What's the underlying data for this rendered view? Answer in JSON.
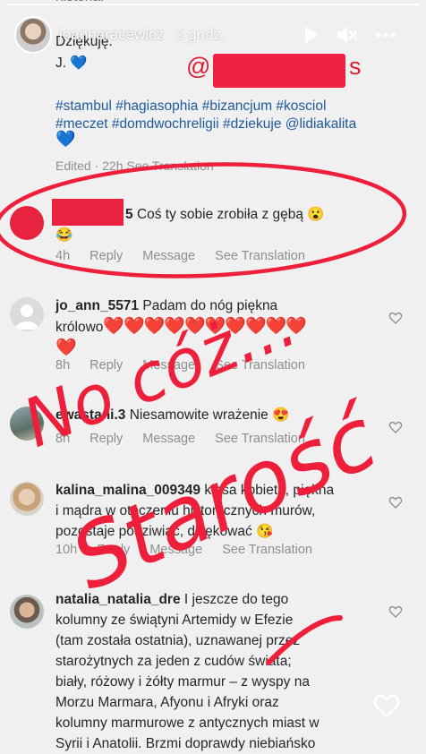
{
  "story": {
    "username": "joannaracewicz",
    "time": "2 godz.",
    "icons": [
      "play-icon",
      "mute-icon",
      "more-icon",
      "like-icon"
    ]
  },
  "caption": {
    "line_top": "historia.",
    "line_thanks": "Dziękuję.",
    "line_sign": "J. 💙",
    "mention_visible": "@",
    "mention_tail": "s",
    "hashtags_1": "#stambul #hagiasophia #bizancjum #kosciol",
    "hashtags_2": "#meczet #domdwochreligii #dziekuje @lidiakalita",
    "hashtags_3": "💙",
    "meta": "Edited · 22h    See Translation"
  },
  "comments": [
    {
      "user": "",
      "user_suffix": "5",
      "text": "Coś ty sobie zrobiła z gębą 😮",
      "text2": "😂",
      "time": "4h",
      "reply": "Reply",
      "message": "Message",
      "translate": "See Translation"
    },
    {
      "user": "jo_ann_5571",
      "text": "Padam do nóg piękna",
      "text2": "królowo",
      "hearts": "❤️❤️❤️❤️❤️❤️❤️❤️❤️❤️",
      "hearts2": "❤️",
      "time": "8h",
      "reply": "Reply",
      "message": "Message",
      "translate": "See Translation"
    },
    {
      "user": "ewastani.3",
      "text": "Niesamowite wrażenie 😍",
      "time": "8h",
      "reply": "Reply",
      "message": "Message",
      "translate": "See Translation"
    },
    {
      "user": "kalina_malina_009349",
      "text": "klasa kobieta, piękna",
      "text2": "i mądra w otoczeniu historycznych murów,",
      "text3": "pozostaje podziwiać, dziękować 😘",
      "time": "10h",
      "reply": "Reply",
      "message": "Message",
      "translate": "See Translation"
    },
    {
      "user": "natalia_natalia_dre",
      "lines": [
        "I jeszcze do tego",
        "kolumny ze świątyni Artemidy w Efezie",
        "(tam została ostatnia), uznawanej przez",
        "starożytnych za jeden z cudów świata;",
        "biały, różowy i żółty marmur – z wyspy na",
        "Morzu Marmara, Afyonu i Afryki  oraz",
        "kolumny marmurowe z antycznych miast w",
        "Syrii i Anatolii. Brzmi doprawdy niebiańsko"
      ]
    }
  ],
  "handwriting": {
    "text_1": "No cóż...",
    "text_2": "Starość",
    "color": "#ee1f3b"
  },
  "colors": {
    "background": "#f0f0f0",
    "hashtag": "#1e5a9b",
    "muted": "#8e8e8e",
    "red": "#ee1f3b"
  }
}
